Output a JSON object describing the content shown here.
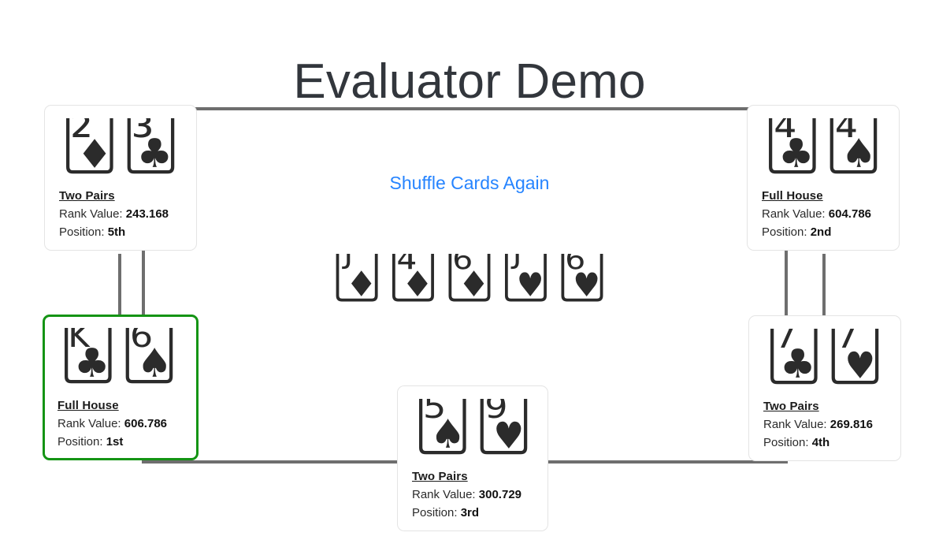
{
  "page": {
    "title": "Evaluator Demo"
  },
  "actions": {
    "shuffle_label": "Shuffle Cards Again"
  },
  "labels": {
    "rank_value": "Rank Value:",
    "position": "Position:"
  },
  "colors": {
    "link": "#2684ff",
    "winner_border": "#149414",
    "table_border": "#6e6e6e",
    "panel_border": "#e4e4e4",
    "text": "#2b2b2b"
  },
  "community_cards": [
    {
      "glyph": "🃋",
      "rank": "J",
      "suit": "diamonds",
      "name": "jack-of-diamonds"
    },
    {
      "glyph": "🃄",
      "rank": "4",
      "suit": "diamonds",
      "name": "four-of-diamonds"
    },
    {
      "glyph": "🃆",
      "rank": "6",
      "suit": "diamonds",
      "name": "six-of-diamonds"
    },
    {
      "glyph": "🂻",
      "rank": "J",
      "suit": "hearts",
      "name": "jack-of-hearts"
    },
    {
      "glyph": "🂶",
      "rank": "6",
      "suit": "hearts",
      "name": "six-of-hearts"
    }
  ],
  "players": [
    {
      "id": "p5",
      "hand_name": "Two Pairs",
      "rank_value": "243.168",
      "position": "5th",
      "winner": false,
      "cards": [
        {
          "glyph": "🃂",
          "rank": "2",
          "suit": "diamonds",
          "name": "two-of-diamonds"
        },
        {
          "glyph": "🃓",
          "rank": "3",
          "suit": "clubs",
          "name": "three-of-clubs"
        }
      ]
    },
    {
      "id": "p1",
      "hand_name": "Full House",
      "rank_value": "606.786",
      "position": "1st",
      "winner": true,
      "cards": [
        {
          "glyph": "🃞",
          "rank": "K",
          "suit": "clubs",
          "name": "king-of-clubs"
        },
        {
          "glyph": "🂦",
          "rank": "6",
          "suit": "spades",
          "name": "six-of-spades"
        }
      ]
    },
    {
      "id": "p2",
      "hand_name": "Full House",
      "rank_value": "604.786",
      "position": "2nd",
      "winner": false,
      "cards": [
        {
          "glyph": "🃔",
          "rank": "4",
          "suit": "clubs",
          "name": "four-of-clubs"
        },
        {
          "glyph": "🂤",
          "rank": "4",
          "suit": "spades",
          "name": "four-of-spades"
        }
      ]
    },
    {
      "id": "p4",
      "hand_name": "Two Pairs",
      "rank_value": "269.816",
      "position": "4th",
      "winner": false,
      "cards": [
        {
          "glyph": "🃗",
          "rank": "7",
          "suit": "clubs",
          "name": "seven-of-clubs"
        },
        {
          "glyph": "🂷",
          "rank": "7",
          "suit": "hearts",
          "name": "seven-of-hearts"
        }
      ]
    },
    {
      "id": "p3",
      "hand_name": "Two Pairs",
      "rank_value": "300.729",
      "position": "3rd",
      "winner": false,
      "cards": [
        {
          "glyph": "🂥",
          "rank": "5",
          "suit": "spades",
          "name": "five-of-spades"
        },
        {
          "glyph": "🂹",
          "rank": "9",
          "suit": "hearts",
          "name": "nine-of-hearts"
        }
      ]
    }
  ]
}
